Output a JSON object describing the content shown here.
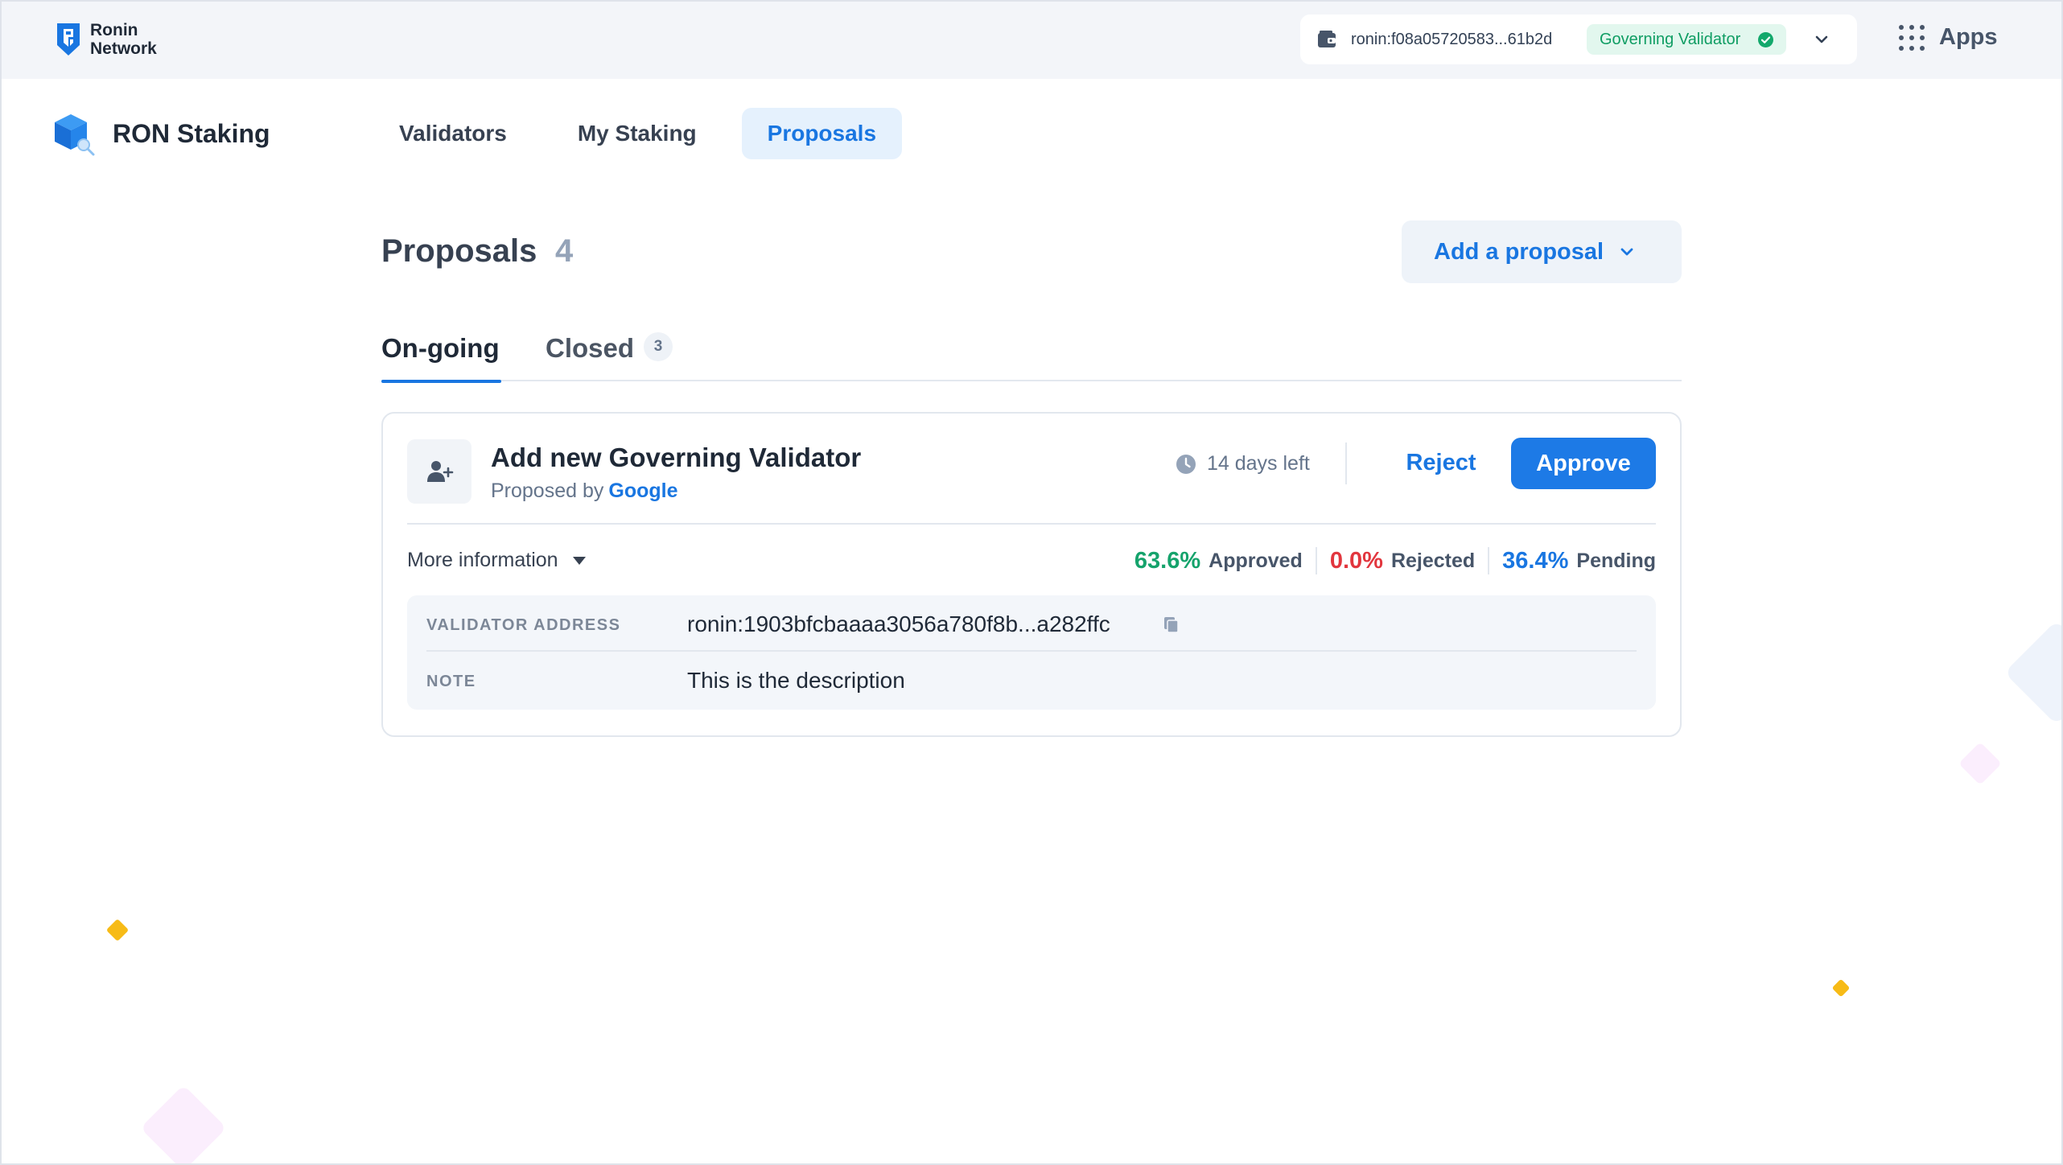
{
  "topbar": {
    "logo_line1": "Ronin",
    "logo_line2": "Network",
    "wallet_address": "ronin:f08a05720583...61b2d",
    "role_badge": "Governing Validator",
    "apps_label": "Apps"
  },
  "app": {
    "name": "RON Staking",
    "nav": [
      {
        "label": "Validators",
        "active": false
      },
      {
        "label": "My Staking",
        "active": false
      },
      {
        "label": "Proposals",
        "active": true
      }
    ]
  },
  "page": {
    "title": "Proposals",
    "count": "4",
    "add_button": "Add a proposal",
    "tabs": {
      "ongoing": "On-going",
      "closed": "Closed",
      "closed_count": "3"
    }
  },
  "proposal": {
    "icon": "user-plus-icon",
    "title": "Add new Governing Validator",
    "proposed_by_label": "Proposed by",
    "proposer": "Google",
    "time_left": "14 days left",
    "reject_label": "Reject",
    "approve_label": "Approve",
    "more_info_label": "More information",
    "stats": {
      "approved_pct": "63.6%",
      "approved_label": "Approved",
      "rejected_pct": "0.0%",
      "rejected_label": "Rejected",
      "pending_pct": "36.4%",
      "pending_label": "Pending"
    },
    "details": {
      "address_label": "VALIDATOR ADDRESS",
      "address_value": "ronin:1903bfcbaaaa3056a780f8b...a282ffc",
      "note_label": "NOTE",
      "note_value": "This is the description"
    }
  },
  "colors": {
    "accent": "#1976e1",
    "approved": "#15a36c",
    "rejected": "#e2363e",
    "badge_bg": "#e2f7ee"
  }
}
